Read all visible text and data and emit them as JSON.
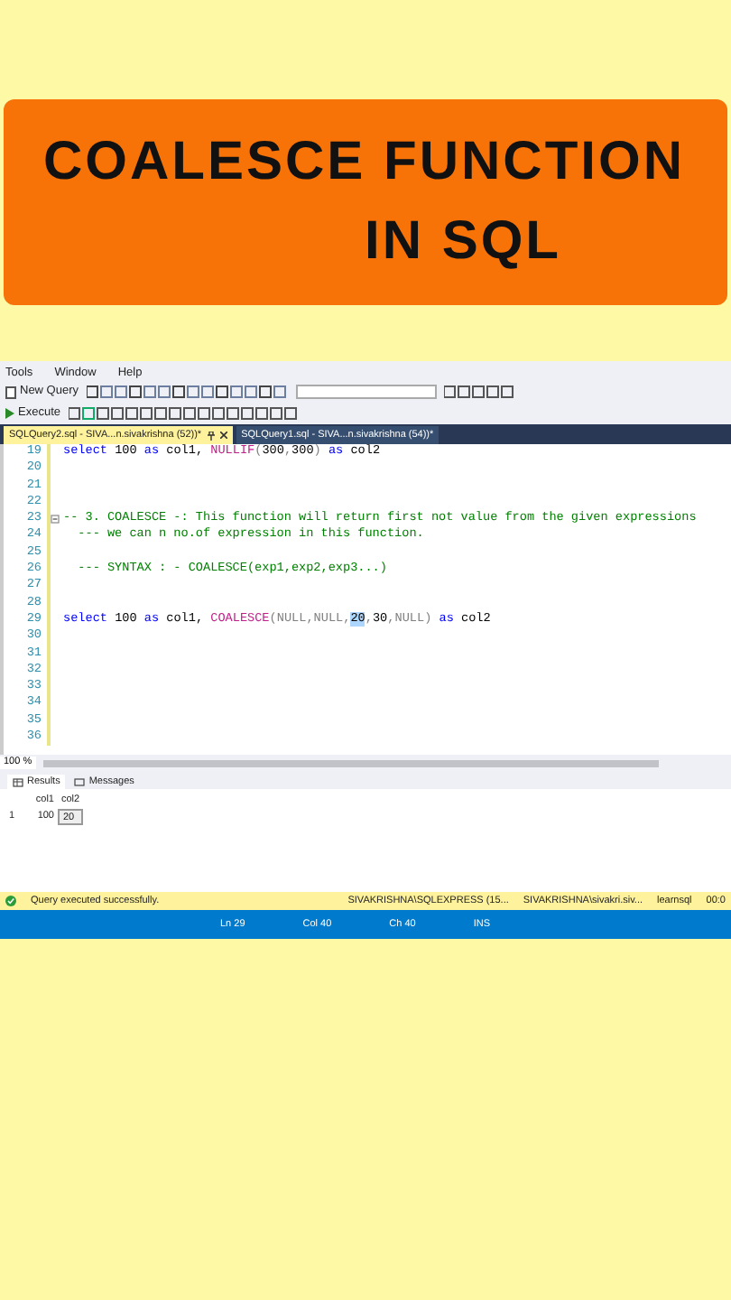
{
  "banner": {
    "lines": [
      "COALESCE FUNCTION",
      "IN SQL"
    ]
  },
  "menu": [
    "Tools",
    "Window",
    "Help"
  ],
  "toolbar": {
    "new_query": "New Query",
    "execute": "Execute"
  },
  "tabs": [
    {
      "label": "SQLQuery2.sql - SIVA...n.sivakrishna (52))*",
      "selected": true
    },
    {
      "label": "SQLQuery1.sql - SIVA...n.sivakrishna (54))*",
      "selected": false
    }
  ],
  "editor": {
    "lines": [
      {
        "number": "19",
        "segments": [
          {
            "kind": "keyword",
            "text": "select"
          },
          {
            "kind": "plain",
            "text": " 100 "
          },
          {
            "kind": "keyword",
            "text": "as"
          },
          {
            "kind": "plain",
            "text": " col1, "
          },
          {
            "kind": "function",
            "text": "NULLIF"
          },
          {
            "kind": "operator",
            "text": "("
          },
          {
            "kind": "plain",
            "text": "300"
          },
          {
            "kind": "operator",
            "text": ","
          },
          {
            "kind": "plain",
            "text": "300"
          },
          {
            "kind": "operator",
            "text": ") "
          },
          {
            "kind": "keyword",
            "text": "as"
          },
          {
            "kind": "plain",
            "text": " col2"
          }
        ]
      },
      {
        "number": "20"
      },
      {
        "number": "21"
      },
      {
        "number": "22"
      },
      {
        "number": "23",
        "collapsible": true,
        "segments": [
          {
            "kind": "comment",
            "text": "-- 3. COALESCE -: This function will return first not value from the given expressions"
          }
        ]
      },
      {
        "number": "24",
        "segments": [
          {
            "kind": "comment",
            "text": "  --- we can n no.of expression in this function."
          }
        ]
      },
      {
        "number": "25"
      },
      {
        "number": "26",
        "segments": [
          {
            "kind": "comment",
            "text": "  --- SYNTAX : - COALESCE(exp1,exp2,exp3...)"
          }
        ]
      },
      {
        "number": "27"
      },
      {
        "number": "28"
      },
      {
        "number": "29",
        "segments": [
          {
            "kind": "keyword",
            "text": "select"
          },
          {
            "kind": "plain",
            "text": " 100 "
          },
          {
            "kind": "keyword",
            "text": "as"
          },
          {
            "kind": "plain",
            "text": " col1, "
          },
          {
            "kind": "function",
            "text": "COALESCE"
          },
          {
            "kind": "operator",
            "text": "("
          },
          {
            "kind": "null",
            "text": "NULL"
          },
          {
            "kind": "operator",
            "text": ","
          },
          {
            "kind": "null",
            "text": "NULL"
          },
          {
            "kind": "operator",
            "text": ","
          },
          {
            "kind": "selection",
            "text": "20"
          },
          {
            "kind": "operator",
            "text": ","
          },
          {
            "kind": "plain",
            "text": "30"
          },
          {
            "kind": "operator",
            "text": ","
          },
          {
            "kind": "null",
            "text": "NULL"
          },
          {
            "kind": "operator",
            "text": ") "
          },
          {
            "kind": "keyword",
            "text": "as"
          },
          {
            "kind": "plain",
            "text": " col2"
          }
        ]
      },
      {
        "number": "30"
      },
      {
        "number": "31"
      },
      {
        "number": "32"
      },
      {
        "number": "33"
      },
      {
        "number": "34"
      },
      {
        "number": "35"
      },
      {
        "number": "36"
      }
    ]
  },
  "zoom": "100 %",
  "result_tabs": [
    {
      "label": "Results",
      "selected": true
    },
    {
      "label": "Messages",
      "selected": false
    }
  ],
  "grid": {
    "columns": [
      "col1",
      "col2"
    ],
    "rows": [
      {
        "number": "1",
        "cells": [
          "100",
          "20"
        ]
      }
    ]
  },
  "status": {
    "message": "Query executed successfully.",
    "server": "SIVAKRISHNA\\SQLEXPRESS (15...",
    "user": "SIVAKRISHNA\\sivakri.siv...",
    "database": "learnsql",
    "time": "00:0"
  },
  "position": [
    "Ln 29",
    "Col 40",
    "Ch 40",
    "INS"
  ]
}
